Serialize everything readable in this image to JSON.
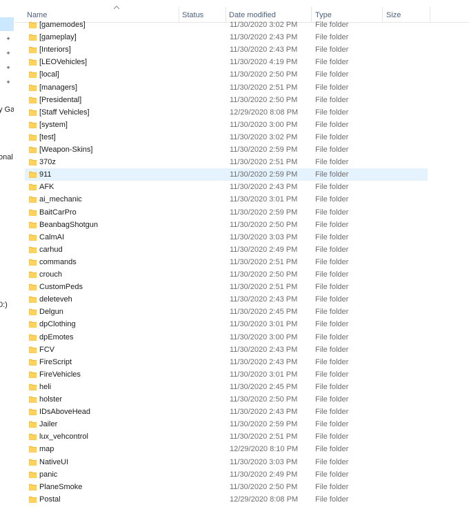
{
  "columns": {
    "name": "Name",
    "status": "Status",
    "date_modified": "Date modified",
    "type": "Type",
    "size": "Size"
  },
  "nav_fragments": {
    "gallery": "y Gall",
    "personal": "onal",
    "drive": "0:)"
  },
  "rows": [
    {
      "name": "[gamemodes]",
      "date": "11/30/2020 3:02 PM",
      "type": "File folder"
    },
    {
      "name": "[gameplay]",
      "date": "11/30/2020 2:43 PM",
      "type": "File folder"
    },
    {
      "name": "[Interiors]",
      "date": "11/30/2020 2:43 PM",
      "type": "File folder"
    },
    {
      "name": "[LEOVehicles]",
      "date": "11/30/2020 4:19 PM",
      "type": "File folder"
    },
    {
      "name": "[local]",
      "date": "11/30/2020 2:50 PM",
      "type": "File folder"
    },
    {
      "name": "[managers]",
      "date": "11/30/2020 2:51 PM",
      "type": "File folder"
    },
    {
      "name": "[Presidental]",
      "date": "11/30/2020 2:50 PM",
      "type": "File folder"
    },
    {
      "name": "[Staff Vehicles]",
      "date": "12/29/2020 8:08 PM",
      "type": "File folder"
    },
    {
      "name": "[system]",
      "date": "11/30/2020 3:00 PM",
      "type": "File folder"
    },
    {
      "name": "[test]",
      "date": "11/30/2020 3:02 PM",
      "type": "File folder"
    },
    {
      "name": "[Weapon-Skins]",
      "date": "11/30/2020 2:59 PM",
      "type": "File folder"
    },
    {
      "name": "370z",
      "date": "11/30/2020 2:51 PM",
      "type": "File folder"
    },
    {
      "name": "911",
      "date": "11/30/2020 2:59 PM",
      "type": "File folder"
    },
    {
      "name": "AFK",
      "date": "11/30/2020 2:43 PM",
      "type": "File folder"
    },
    {
      "name": "ai_mechanic",
      "date": "11/30/2020 3:01 PM",
      "type": "File folder"
    },
    {
      "name": "BaitCarPro",
      "date": "11/30/2020 2:59 PM",
      "type": "File folder"
    },
    {
      "name": "BeanbagShotgun",
      "date": "11/30/2020 2:50 PM",
      "type": "File folder"
    },
    {
      "name": "CalmAI",
      "date": "11/30/2020 3:03 PM",
      "type": "File folder"
    },
    {
      "name": "carhud",
      "date": "11/30/2020 2:49 PM",
      "type": "File folder"
    },
    {
      "name": "commands",
      "date": "11/30/2020 2:51 PM",
      "type": "File folder"
    },
    {
      "name": "crouch",
      "date": "11/30/2020 2:50 PM",
      "type": "File folder"
    },
    {
      "name": "CustomPeds",
      "date": "11/30/2020 2:51 PM",
      "type": "File folder"
    },
    {
      "name": "deleteveh",
      "date": "11/30/2020 2:43 PM",
      "type": "File folder"
    },
    {
      "name": "Delgun",
      "date": "11/30/2020 2:45 PM",
      "type": "File folder"
    },
    {
      "name": "dpClothing",
      "date": "11/30/2020 3:01 PM",
      "type": "File folder"
    },
    {
      "name": "dpEmotes",
      "date": "11/30/2020 3:00 PM",
      "type": "File folder"
    },
    {
      "name": "FCV",
      "date": "11/30/2020 2:43 PM",
      "type": "File folder"
    },
    {
      "name": "FireScript",
      "date": "11/30/2020 2:43 PM",
      "type": "File folder"
    },
    {
      "name": "FireVehicles",
      "date": "11/30/2020 3:01 PM",
      "type": "File folder"
    },
    {
      "name": "heli",
      "date": "11/30/2020 2:45 PM",
      "type": "File folder"
    },
    {
      "name": "holster",
      "date": "11/30/2020 2:50 PM",
      "type": "File folder"
    },
    {
      "name": "IDsAboveHead",
      "date": "11/30/2020 2:43 PM",
      "type": "File folder"
    },
    {
      "name": "Jailer",
      "date": "11/30/2020 2:59 PM",
      "type": "File folder"
    },
    {
      "name": "lux_vehcontrol",
      "date": "11/30/2020 2:51 PM",
      "type": "File folder"
    },
    {
      "name": "map",
      "date": "12/29/2020 8:10 PM",
      "type": "File folder"
    },
    {
      "name": "NativeUI",
      "date": "11/30/2020 3:03 PM",
      "type": "File folder"
    },
    {
      "name": "panic",
      "date": "11/30/2020 2:49 PM",
      "type": "File folder"
    },
    {
      "name": "PlaneSmoke",
      "date": "11/30/2020 2:50 PM",
      "type": "File folder"
    },
    {
      "name": "Postal",
      "date": "12/29/2020 8:08 PM",
      "type": "File folder"
    }
  ],
  "hovered_row_name": "911",
  "colors": {
    "header_text": "#4c607a",
    "secondary_text": "#6d6d6d",
    "hover_row": "#e5f3ff",
    "nav_selected": "#cce8ff",
    "folder_body": "#ffd35c",
    "folder_tab": "#e8b33a"
  },
  "icons": {
    "folder": "folder-icon",
    "pin": "pin-icon",
    "sort": "sort-ascending-icon"
  }
}
